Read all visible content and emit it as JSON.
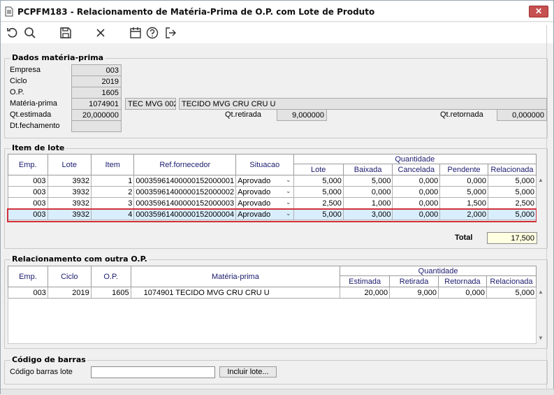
{
  "window": {
    "title": "PCPFM183 - Relacionamento de Matéria-Prima de O.P. com Lote de Produto",
    "close_glyph": "✕"
  },
  "toolbar": {
    "icons": [
      "undo-icon",
      "search-icon",
      "save-icon",
      "close-icon",
      "calendar-icon",
      "help-icon",
      "exit-icon"
    ]
  },
  "dados": {
    "title": "Dados matéria-prima",
    "empresa_label": "Empresa",
    "empresa": "003",
    "ciclo_label": "Ciclo",
    "ciclo": "2019",
    "op_label": "O.P.",
    "op": "1605",
    "materia_label": "Matéria-prima",
    "materia_code": "1074901",
    "materia_ref": "TEC MVG 002",
    "materia_desc": "TECIDO MVG CRU CRU U",
    "qt_estimada_label": "Qt.estimada",
    "qt_estimada": "20,000000",
    "qt_retirada_label": "Qt.retirada",
    "qt_retirada": "9,000000",
    "qt_retornada_label": "Qt.retornada",
    "qt_retornada": "0,000000",
    "dt_fechamento_label": "Dt.fechamento",
    "dt_fechamento": ""
  },
  "item_lote": {
    "title": "Item de lote",
    "headers": {
      "emp": "Emp.",
      "lote": "Lote",
      "item": "Item",
      "ref": "Ref.fornecedor",
      "situacao": "Situacao",
      "quantidade": "Quantidade",
      "q_lote": "Lote",
      "baixada": "Baixada",
      "cancelada": "Cancelada",
      "pendente": "Pendente",
      "relacionada": "Relacionada"
    },
    "rows": [
      {
        "emp": "003",
        "lote": "3932",
        "item": "1",
        "ref": "00035961400000152000001",
        "situacao": "Aprovado",
        "q_lote": "5,000",
        "baixada": "5,000",
        "cancelada": "0,000",
        "pendente": "0,000",
        "relacionada": "5,000"
      },
      {
        "emp": "003",
        "lote": "3932",
        "item": "2",
        "ref": "00035961400000152000002",
        "situacao": "Aprovado",
        "q_lote": "5,000",
        "baixada": "0,000",
        "cancelada": "0,000",
        "pendente": "5,000",
        "relacionada": "5,000"
      },
      {
        "emp": "003",
        "lote": "3932",
        "item": "3",
        "ref": "00035961400000152000003",
        "situacao": "Aprovado",
        "q_lote": "2,500",
        "baixada": "1,000",
        "cancelada": "0,000",
        "pendente": "1,500",
        "relacionada": "2,500"
      },
      {
        "emp": "003",
        "lote": "3932",
        "item": "4",
        "ref": "00035961400000152000004",
        "situacao": "Aprovado",
        "q_lote": "5,000",
        "baixada": "3,000",
        "cancelada": "0,000",
        "pendente": "2,000",
        "relacionada": "5,000"
      }
    ],
    "total_label": "Total",
    "total": "17,500"
  },
  "relacionamento": {
    "title": "Relacionamento com outra O.P.",
    "headers": {
      "emp": "Emp.",
      "ciclo": "Ciclo",
      "op": "O.P.",
      "materia": "Matéria-prima",
      "quantidade": "Quantidade",
      "estimada": "Estimada",
      "retirada": "Retirada",
      "retornada": "Retornada",
      "relacionada": "Relacionada"
    },
    "rows": [
      {
        "emp": "003",
        "ciclo": "2019",
        "op": "1605",
        "materia": "1074901 TECIDO MVG CRU CRU U",
        "estimada": "20,000",
        "retirada": "9,000",
        "retornada": "0,000",
        "relacionada": "5,000"
      }
    ]
  },
  "barras": {
    "title": "Código de barras",
    "label": "Código barras lote",
    "value": "",
    "button": "Incluir lote..."
  }
}
